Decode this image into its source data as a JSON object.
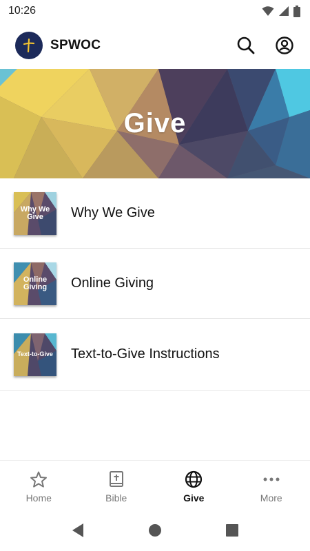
{
  "status_bar": {
    "time": "10:26"
  },
  "app_bar": {
    "title": "SPWOC"
  },
  "banner": {
    "title": "Give"
  },
  "items": [
    {
      "thumb_text": "Why We Give",
      "label": "Why We Give"
    },
    {
      "thumb_text": "Online Giving",
      "label": "Online Giving"
    },
    {
      "thumb_text": "Text-to-Give",
      "label": "Text-to-Give Instructions"
    }
  ],
  "bottom_nav": [
    {
      "label": "Home",
      "icon": "star-icon",
      "active": false
    },
    {
      "label": "Bible",
      "icon": "bible-icon",
      "active": false
    },
    {
      "label": "Give",
      "icon": "globe-icon",
      "active": true
    },
    {
      "label": "More",
      "icon": "more-icon",
      "active": false
    }
  ],
  "colors": {
    "logo_bg": "#1c2a5a",
    "logo_cross": "#f2c230",
    "active_tab": "#111111",
    "inactive_tab": "#777777"
  }
}
